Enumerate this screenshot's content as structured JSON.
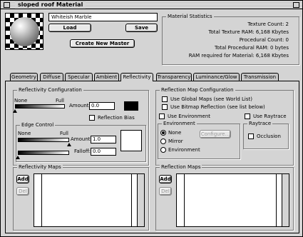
{
  "window": {
    "title": "sloped roof Material"
  },
  "material": {
    "name": "Whiteish Marble"
  },
  "buttons": {
    "load": "Load",
    "save": "Save",
    "create_master": "Create New Master"
  },
  "stats": {
    "title": "Material Statistics",
    "lines": [
      "Texture Count: 2",
      "Total Texture RAM: 6,168 Kbytes",
      "Procedural Count: 0",
      "Total Procedural RAM: 0 bytes",
      "RAM required for Material: 6,168 Kbytes"
    ]
  },
  "tabs": [
    "Geometry",
    "Diffuse",
    "Specular",
    "Ambient",
    "Reflectivity",
    "Transparency",
    "Luminance/Glow",
    "Transmission"
  ],
  "active_tab": "Reflectivity",
  "reflectivity": {
    "title": "Reflectivity Configuration",
    "none": "None",
    "full": "Full",
    "amount_label": "Amount:",
    "amount_value": "0.0",
    "amount_level": 0.0,
    "reflection_bias": "Reflection Bias"
  },
  "edge": {
    "title": "Edge Control",
    "none": "None",
    "full": "Full",
    "amount_label": "Amount:",
    "amount_value": "1.0",
    "amount_level": 1.0,
    "falloff_label": "Falloff:",
    "falloff_value": "0.0"
  },
  "reflection_map": {
    "title": "Reflection Map Configuration",
    "global_maps": "Use Global Maps (see World List)",
    "bitmap_reflection": "Use Bitmap Reflection (see list below)",
    "use_environment": "Use Environment",
    "use_raytrace": "Use Raytrace",
    "environment_title": "Environment",
    "env_options": [
      "None",
      "Mirror",
      "Environment"
    ],
    "env_selected": "None",
    "configure": "Configure...",
    "raytrace_title": "Raytrace",
    "occlusion": "Occlusion"
  },
  "reflectivity_maps": {
    "title": "Reflectivity Maps",
    "add": "Add",
    "del": "Del"
  },
  "reflection_maps": {
    "title": "Reflection Maps",
    "add": "Add",
    "del": "Del"
  },
  "colors": {
    "swatch_amount": "#000000",
    "swatch_edge": "#ffffff"
  }
}
